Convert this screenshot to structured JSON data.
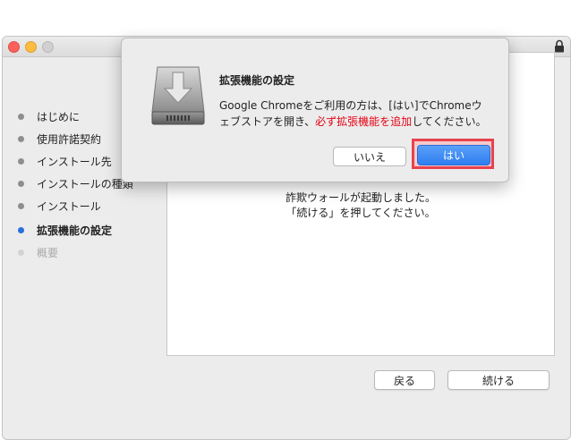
{
  "sidebar": {
    "steps": [
      {
        "label": "はじめに"
      },
      {
        "label": "使用許諾契約"
      },
      {
        "label": "インストール先"
      },
      {
        "label": "インストールの種類"
      },
      {
        "label": "インストール"
      },
      {
        "label": "拡張機能の設定"
      },
      {
        "label": "概要"
      }
    ],
    "active_index": 5
  },
  "main": {
    "message_line1": "詐欺ウォールが起動しました。",
    "message_line2": "「続ける」を押してください。"
  },
  "footer": {
    "back_label": "戻る",
    "continue_label": "続ける"
  },
  "dialog": {
    "title": "拡張機能の設定",
    "body_part1": "Google Chromeをご利用の方は、[はい]でChromeウェブストアを開き、",
    "body_highlight": "必ず拡張機能を追加",
    "body_part2": "してください。",
    "no_label": "いいえ",
    "yes_label": "はい",
    "icon": "installer-disk-icon"
  },
  "colors": {
    "accent": "#2a6fdb",
    "highlight_text": "#e60012",
    "annotation_box": "#e8424e"
  }
}
